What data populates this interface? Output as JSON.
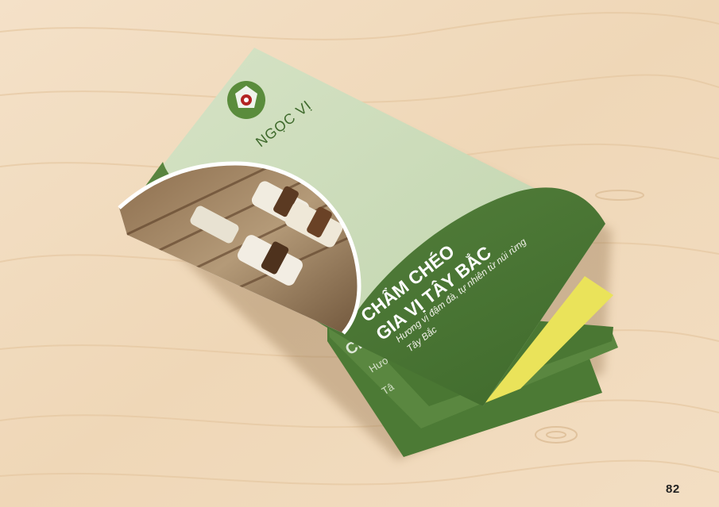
{
  "brochure": {
    "brand_name": "NGỌC VỊ",
    "title_line1": "CHẨM CHÉO",
    "title_line2": "GIA VỊ TÂY BẮC",
    "subtitle_line1": "Hương vị đậm đà, tự nhiên từ núi rừng",
    "subtitle_line2": "Tây Bắc"
  },
  "page": {
    "number": "82"
  },
  "colors": {
    "wood": "#f1dcc0",
    "brochure_dark_green": "#4f7a38",
    "brochure_light_green": "#cddcbd",
    "accent_yellow": "#eae35a"
  }
}
